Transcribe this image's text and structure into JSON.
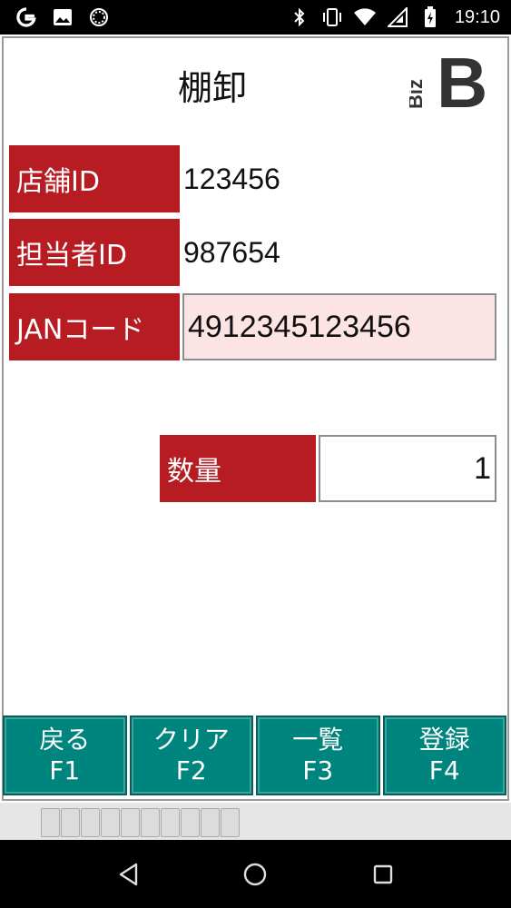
{
  "status_bar": {
    "left_icons": [
      "google-icon",
      "image-icon",
      "circle-grid-icon"
    ],
    "right_icons": [
      "bluetooth-icon",
      "vibrate-icon",
      "wifi-icon",
      "signal-icon",
      "battery-icon"
    ],
    "time": "19:10"
  },
  "header": {
    "title": "棚卸",
    "logo_small": "Biz",
    "logo_big": "B"
  },
  "form": {
    "store_id_label": "店舗ID",
    "store_id_value": "123456",
    "staff_id_label": "担当者ID",
    "staff_id_value": "987654",
    "jan_label": "JANコード",
    "jan_value": "4912345123456",
    "quantity_label": "数量",
    "quantity_value": "1"
  },
  "function_keys": [
    {
      "label": "戻る",
      "key": "F1"
    },
    {
      "label": "クリア",
      "key": "F2"
    },
    {
      "label": "一覧",
      "key": "F3"
    },
    {
      "label": "登録",
      "key": "F4"
    }
  ],
  "colors": {
    "label_bg": "#b71c23",
    "jan_input_bg": "#fde4e4",
    "fn_button_bg": "#00847e"
  },
  "progress_segments": 10
}
